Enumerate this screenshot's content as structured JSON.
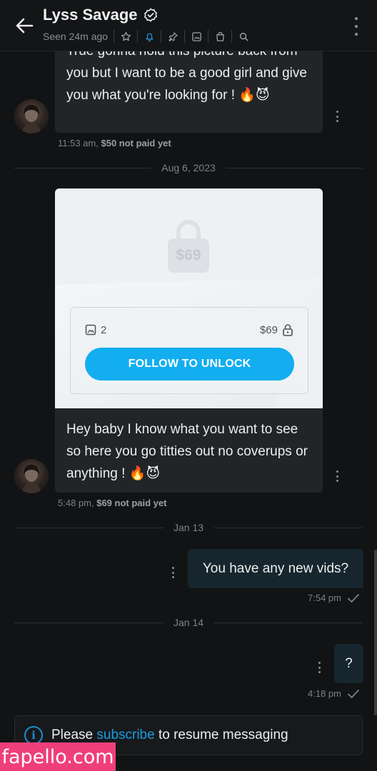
{
  "header": {
    "title": "Lyss Savage",
    "seen": "Seen 24m ago"
  },
  "messages": {
    "m1": {
      "text": "True gonna hold this picture back from you but I want to be a good girl and give you what you're looking for ! 🔥😈",
      "time": "11:53 am,",
      "price_status": "$50 not paid yet"
    },
    "divider_aug": "Aug 6, 2023",
    "locked_post": {
      "lock_price": "$69",
      "media_count": "2",
      "price": "$69",
      "button": "FOLLOW TO UNLOCK"
    },
    "m2": {
      "text": "Hey baby I know what you want to see so here you go titties out no coverups or anything ! 🔥😈",
      "time": "5:48 pm,",
      "price_status": "$69 not paid yet"
    },
    "divider_jan13": "Jan 13",
    "out1": {
      "text": "You have any new vids?",
      "time": "7:54 pm"
    },
    "divider_jan14": "Jan 14",
    "out2": {
      "text": "?",
      "time": "4:18 pm"
    }
  },
  "notice": {
    "before": "Please ",
    "link": "subscribe",
    "after": " to resume messaging"
  },
  "watermark": "fapello.com",
  "colors": {
    "accent": "#12aef0",
    "background": "#121314",
    "incoming_bubble": "#222528",
    "outgoing_bubble": "#17262e",
    "watermark": "#ef3f7a"
  }
}
